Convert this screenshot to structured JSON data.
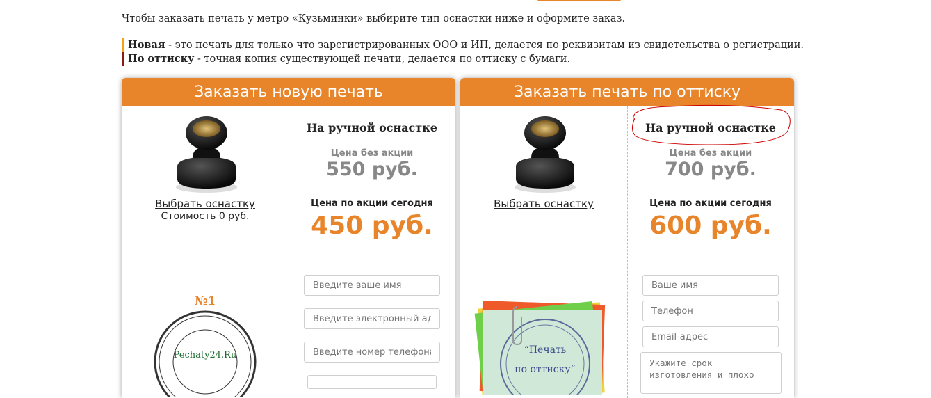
{
  "intro": "Чтобы заказать печать у метро «Кузьминки» выбирите тип оснастки ниже и оформите заказ.",
  "legend": [
    {
      "term": "Новая",
      "desc": " - это печать для только что зарегистрированных ООО и ИП, делается по реквизитам из свидетельства о регистрации."
    },
    {
      "term": "По оттиску",
      "desc": " - точная копия существующей печати, делается по оттиску с бумаги."
    }
  ],
  "cards": [
    {
      "header": "Заказать новую печать",
      "choose_link": "Выбрать оснастку",
      "cost": "Стоимость 0 руб.",
      "price_title": "На ручной оснастке",
      "old_label": "Цена без акции",
      "old_price": "550 руб.",
      "new_label": "Цена по акции сегодня",
      "new_price": "450 руб.",
      "sample_badge": "№1",
      "sample_text": "Pechaty24.Ru",
      "inputs": [
        "Введите ваше имя",
        "Введите электронный адр",
        "Введите номер телефона"
      ]
    },
    {
      "header": "Заказать печать по оттиску",
      "choose_link": "Выбрать оснастку",
      "price_title": "На ручной оснастке",
      "old_label": "Цена без акции",
      "old_price": "700 руб.",
      "new_label": "Цена по акции сегодня",
      "new_price": "600 руб.",
      "sample_text_1": "“Печать",
      "sample_text_2": "по оттиску”",
      "inputs": [
        "Ваше имя",
        "Телефон",
        "Email-адрес"
      ],
      "textarea": "Укажите срок изготовления и плохо"
    }
  ],
  "colors": {
    "accent": "#e8842a",
    "legend_new": "#f5a21b",
    "legend_copy": "#8b1a1a",
    "annotation": "#cc0000"
  }
}
